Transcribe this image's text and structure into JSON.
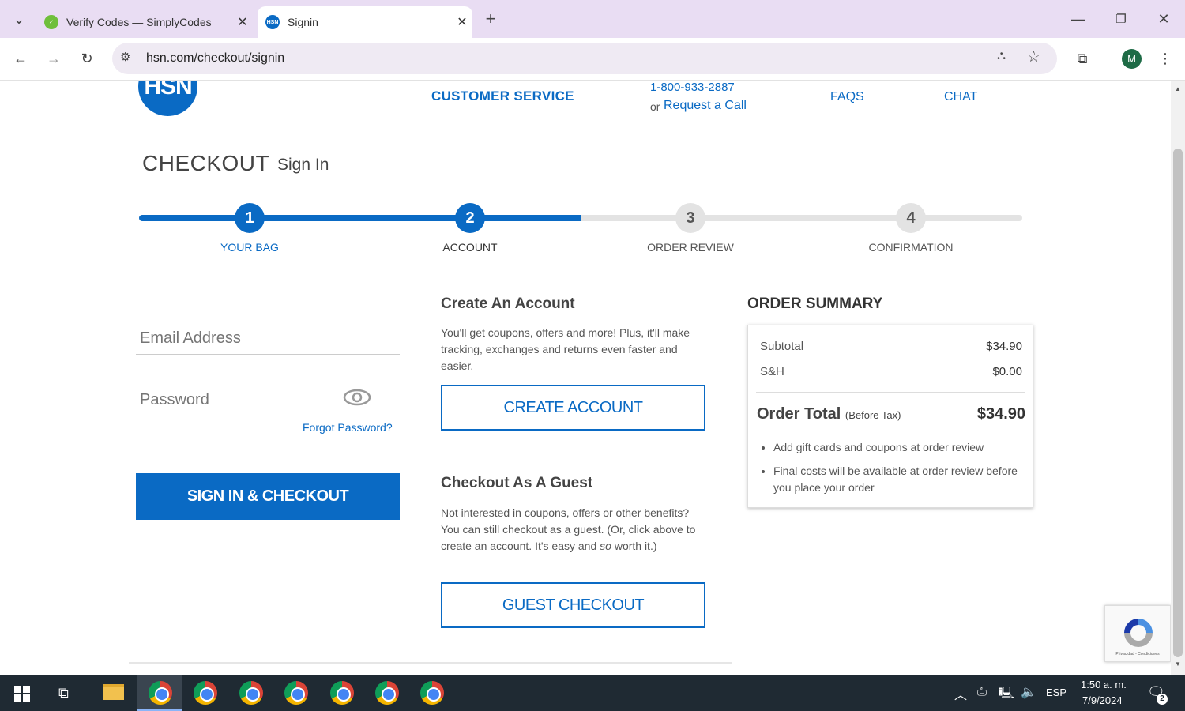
{
  "browser": {
    "tabs": [
      {
        "title": "Verify Codes — SimplyCodes",
        "active": false,
        "favicon_color": "#6fbf3b"
      },
      {
        "title": "Signin",
        "active": true,
        "favicon_color": "#0a6ac4",
        "favicon_text": "HSN"
      }
    ],
    "url": "hsn.com/checkout/signin",
    "profile_initial": "M"
  },
  "header": {
    "logo_text": "HSN",
    "customer_service": "CUSTOMER SERVICE",
    "phone": "1-800-933-2887",
    "or_text": "or",
    "request_call": "Request a Call",
    "faqs": "FAQS",
    "chat": "CHAT"
  },
  "checkout": {
    "title": "CHECKOUT",
    "subtitle": "Sign In",
    "progress_fraction": 0.5,
    "steps": [
      {
        "number": "1",
        "label": "YOUR BAG",
        "state": "done"
      },
      {
        "number": "2",
        "label": "ACCOUNT",
        "state": "current"
      },
      {
        "number": "3",
        "label": "ORDER REVIEW",
        "state": "todo"
      },
      {
        "number": "4",
        "label": "CONFIRMATION",
        "state": "todo"
      }
    ]
  },
  "signin": {
    "email_placeholder": "Email Address",
    "password_placeholder": "Password",
    "forgot_password": "Forgot Password?",
    "submit": "SIGN IN & CHECKOUT"
  },
  "create_account": {
    "title": "Create An Account",
    "description": "You'll get coupons, offers and more! Plus, it'll make tracking, exchanges and returns even faster and easier.",
    "button": "CREATE ACCOUNT"
  },
  "guest": {
    "title": "Checkout As A Guest",
    "description_prefix": "Not interested in coupons, offers or other benefits? You can still checkout as a guest. (Or, click above to create an account. It's easy and ",
    "description_em": "so",
    "description_suffix": " worth it.)",
    "button": "GUEST CHECKOUT"
  },
  "order_summary": {
    "title": "ORDER SUMMARY",
    "subtitle_label": "Subtotal",
    "subtotal_value": "$34.90",
    "sh_label": "S&H",
    "sh_value": "$0.00",
    "total_label": "Order Total",
    "total_note": "(Before Tax)",
    "total_value": "$34.90",
    "notes": [
      "Add gift cards and coupons at order review",
      "Final costs will be available at order review before you place your order"
    ]
  },
  "recaptcha": {
    "footer": "Privacidad - Condiciones"
  },
  "taskbar": {
    "language": "ESP",
    "time": "1:50 a. m.",
    "date": "7/9/2024",
    "notification_count": "2"
  }
}
